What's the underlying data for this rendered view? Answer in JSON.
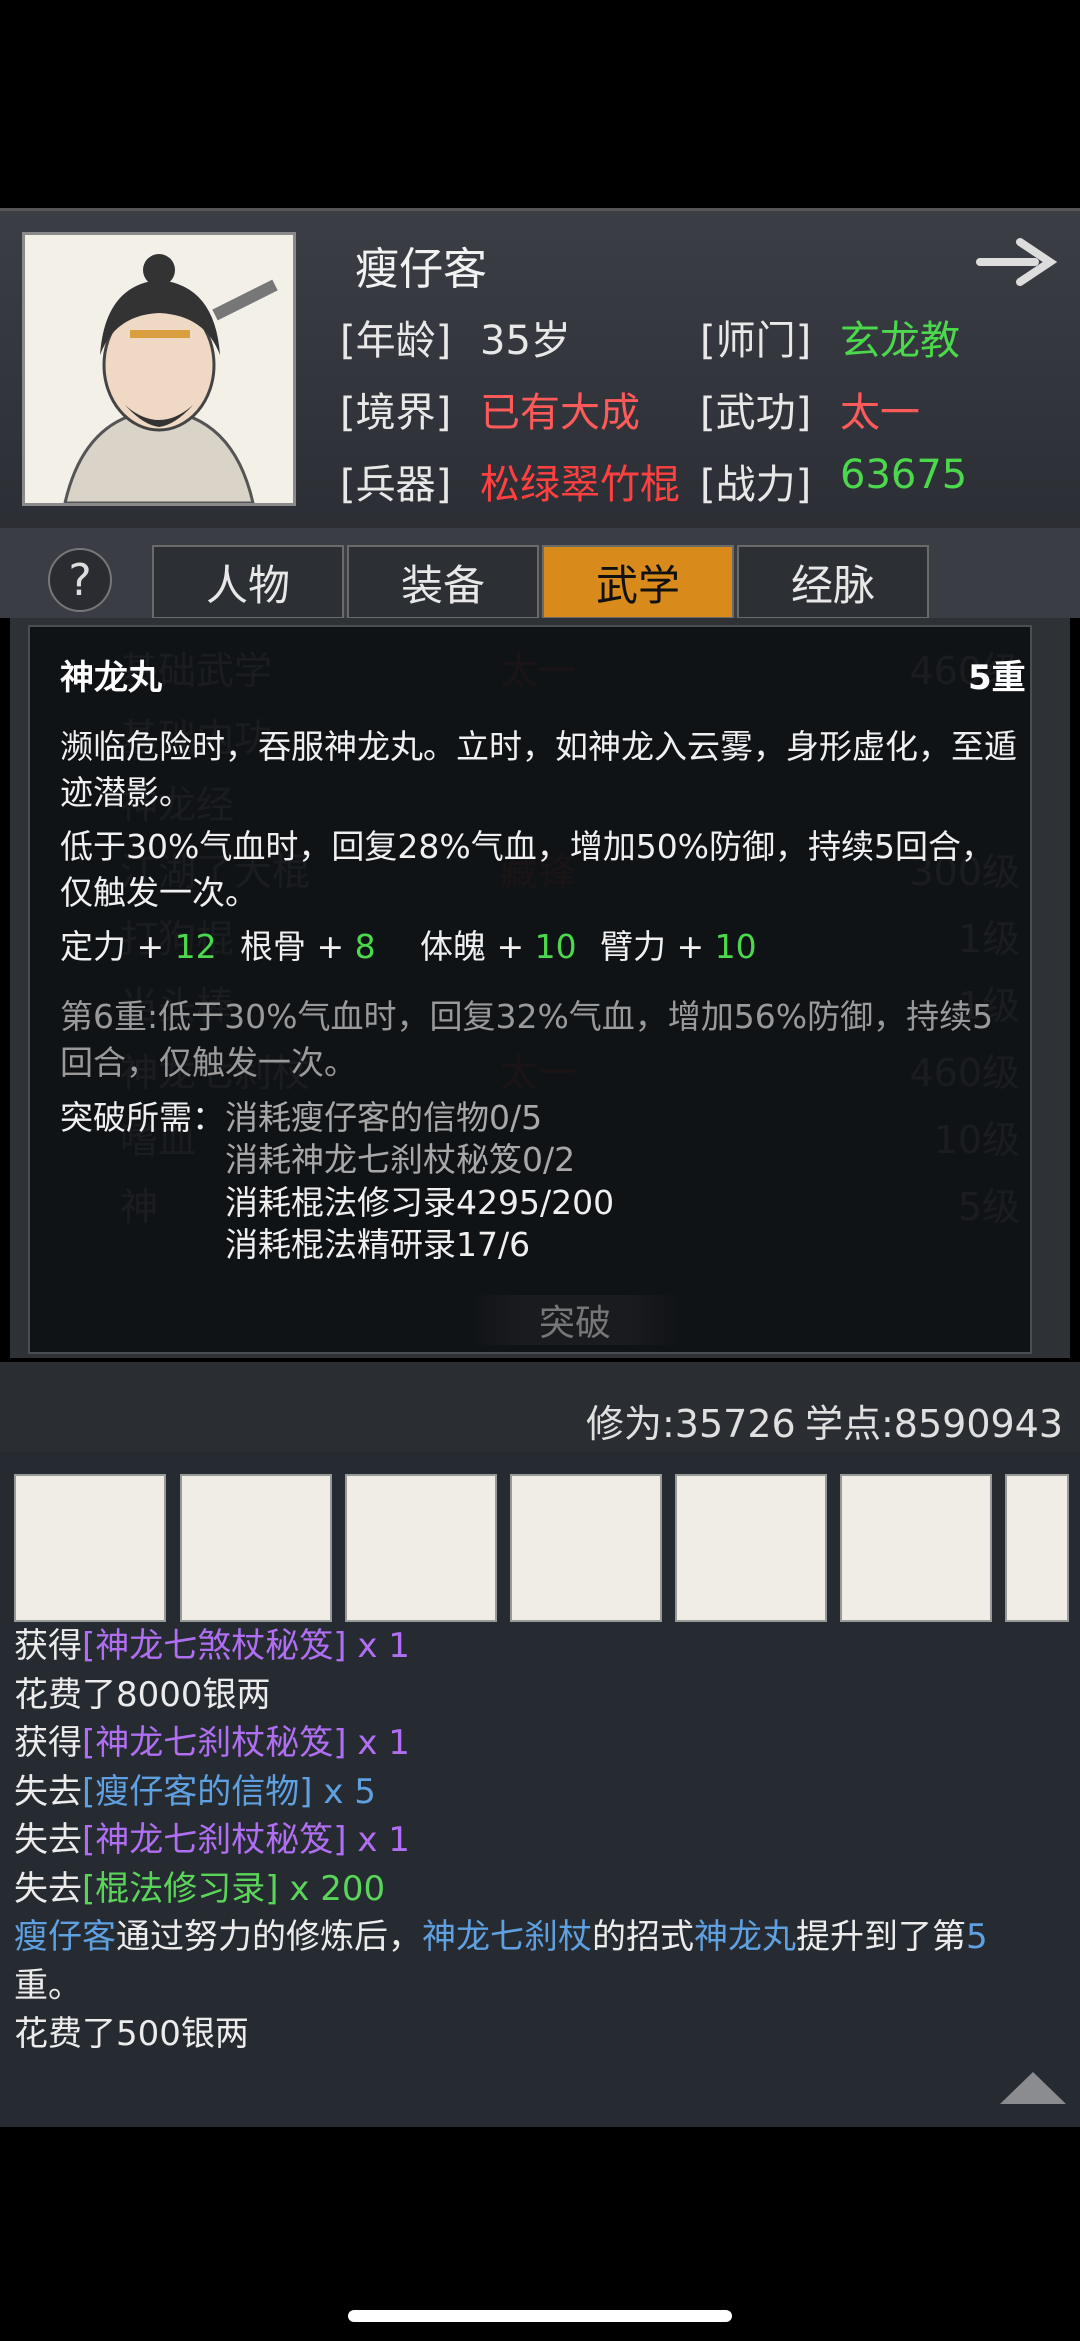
{
  "character": {
    "name": "瘦仔客",
    "age_label": "[年龄]",
    "age_value": "35岁",
    "sect_label": "[师门]",
    "sect_value": "玄龙教",
    "realm_label": "[境界]",
    "realm_value": "已有大成",
    "martial_label": "[武功]",
    "martial_value": "太一",
    "weapon_label": "[兵器]",
    "weapon_value": "松绿翠竹棍",
    "power_label": "[战力]",
    "power_value": "63675"
  },
  "tabs": [
    "人物",
    "装备",
    "武学",
    "经脉"
  ],
  "active_tab": "武学",
  "help_label": "?",
  "background_list": [
    {
      "name": "基础武学",
      "mid": "太一",
      "right": "460级"
    },
    {
      "name": "基础内功",
      "mid": "",
      "right": ""
    },
    {
      "name": "神龙经",
      "mid": "",
      "right": ""
    },
    {
      "name": "江湖了大棍",
      "mid": "藏锋",
      "right": "300级"
    },
    {
      "name": "打狗棍",
      "mid": "",
      "right": "1级"
    },
    {
      "name": "当头棒",
      "mid": "",
      "right": "1级"
    },
    {
      "name": "神龙七刹杖",
      "mid": "太一",
      "right": "460级"
    },
    {
      "name": "嗜血",
      "mid": "",
      "right": "10级"
    },
    {
      "name": "神",
      "mid": "",
      "right": "5级"
    }
  ],
  "popup": {
    "title": "神龙丸",
    "level": "5重",
    "desc1": "濒临危险时，吞服神龙丸。立时，如神龙入云雾，身形虚化，至遁迹潜影。",
    "desc2": "低于30%气血时，回复28%气血，增加50%防御，持续5回合，仅触发一次。",
    "stats": [
      {
        "label": "定力 + ",
        "value": "12"
      },
      {
        "label": "根骨 + ",
        "value": "8"
      },
      {
        "label": "体魄 + ",
        "value": "10"
      },
      {
        "label": "臂力 + ",
        "value": "10"
      }
    ],
    "next_level": "第6重:低于30%气血时，回复32%气血，增加56%防御，持续5回合，仅触发一次。",
    "require_label": "突破所需：",
    "requirements": [
      "消耗瘦仔客的信物0/5",
      "消耗神龙七刹杖秘笈0/2",
      "消耗棍法修习录4295/200",
      "消耗棍法精研录17/6"
    ],
    "break_button": "突破"
  },
  "stats_bar": {
    "cultivation": "修为:35726",
    "points": "学点:8590943"
  },
  "log": [
    [
      {
        "t": "获得"
      },
      {
        "t": "[神龙七煞杖秘笈]",
        "c": "purple"
      },
      {
        "t": " x 1",
        "c": "purple"
      }
    ],
    [
      {
        "t": "花费了8000银两"
      }
    ],
    [
      {
        "t": "获得"
      },
      {
        "t": "[神龙七刹杖秘笈]",
        "c": "purple"
      },
      {
        "t": " x 1",
        "c": "purple"
      }
    ],
    [
      {
        "t": "失去"
      },
      {
        "t": "[瘦仔客的信物]",
        "c": "blue"
      },
      {
        "t": " x 5",
        "c": "blue"
      }
    ],
    [
      {
        "t": "失去"
      },
      {
        "t": "[神龙七刹杖秘笈]",
        "c": "purple"
      },
      {
        "t": " x 1",
        "c": "purple"
      }
    ],
    [
      {
        "t": "失去"
      },
      {
        "t": "[棍法修习录]",
        "c": "green"
      },
      {
        "t": " x 200",
        "c": "green"
      }
    ],
    [
      {
        "t": "瘦仔客",
        "c": "blue"
      },
      {
        "t": "通过努力的修炼后，"
      },
      {
        "t": "神龙七刹杖",
        "c": "blue"
      },
      {
        "t": "的招式"
      },
      {
        "t": "神龙丸",
        "c": "blue"
      },
      {
        "t": "提升到了第"
      },
      {
        "t": "5",
        "c": "blue"
      }
    ],
    [
      {
        "t": "重。"
      }
    ],
    [
      {
        "t": "花费了500银两"
      }
    ]
  ],
  "colors": {
    "accent": "#d88a1a",
    "green": "#4cd84c",
    "red": "#ff5a5a",
    "purple": "#b06ff2",
    "blue": "#5ea0e0"
  }
}
